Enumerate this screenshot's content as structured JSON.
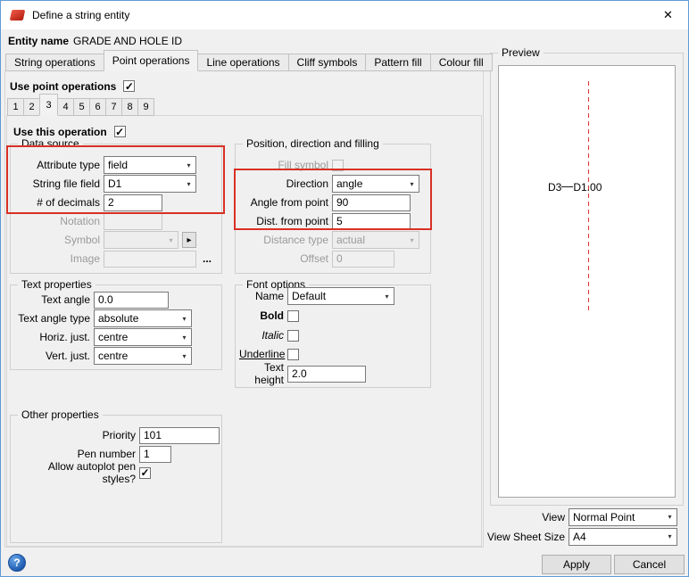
{
  "window": {
    "title": "Define a string entity"
  },
  "icons": {
    "close": "✕",
    "chevron_down": "▾",
    "check": "✓",
    "help": "?",
    "picker": "▸",
    "browse": "..."
  },
  "colors": {
    "annotation": "#d93025",
    "preview_line": "#e03232"
  },
  "entity": {
    "label": "Entity name",
    "value": "GRADE AND HOLE ID"
  },
  "tabs": {
    "items": [
      "String operations",
      "Point operations",
      "Line operations",
      "Cliff symbols",
      "Pattern fill",
      "Colour fill"
    ],
    "active": "Point operations"
  },
  "point_ops": {
    "use_label": "Use point operations"
  },
  "op_tabs": {
    "items": [
      "1",
      "2",
      "3",
      "4",
      "5",
      "6",
      "7",
      "8",
      "9"
    ],
    "active": "3"
  },
  "operation": {
    "use_label": "Use this operation"
  },
  "checks": {
    "use_point_operations": true,
    "use_this_operation": true,
    "fill_symbol": false,
    "bold": false,
    "italic": false,
    "underline": false,
    "autoplot": true
  },
  "data_source": {
    "title": "Data source",
    "attribute_type_label": "Attribute type",
    "attribute_type_value": "field",
    "string_file_field_label": "String file field",
    "string_file_field_value": "D1",
    "decimals_label": "# of decimals",
    "decimals_value": "2",
    "notation_label": "Notation",
    "notation_value": "",
    "symbol_label": "Symbol",
    "symbol_value": "",
    "image_label": "Image",
    "image_value": ""
  },
  "position": {
    "title": "Position, direction and filling",
    "fill_symbol_label": "Fill symbol",
    "direction_label": "Direction",
    "direction_value": "angle",
    "angle_label": "Angle from point",
    "angle_value": "90",
    "dist_label": "Dist. from point",
    "dist_value": "5",
    "distance_type_label": "Distance type",
    "distance_type_value": "actual",
    "offset_label": "Offset",
    "offset_value": "0"
  },
  "text_properties": {
    "title": "Text properties",
    "text_angle_label": "Text angle",
    "text_angle_value": "0.0",
    "text_angle_type_label": "Text angle type",
    "text_angle_type_value": "absolute",
    "horiz_just_label": "Horiz. just.",
    "horiz_just_value": "centre",
    "vert_just_label": "Vert. just.",
    "vert_just_value": "centre"
  },
  "font_options": {
    "title": "Font options",
    "name_label": "Name",
    "name_value": "Default",
    "bold_label": "Bold",
    "italic_label": "Italic",
    "underline_label": "Underline",
    "text_height_label": "Text height",
    "text_height_value": "2.0"
  },
  "other_properties": {
    "title": "Other properties",
    "priority_label": "Priority",
    "priority_value": "101",
    "pen_label": "Pen number",
    "pen_value": "1",
    "autoplot_label": "Allow autoplot pen styles?"
  },
  "preview": {
    "title": "Preview",
    "marker_left": "D3",
    "marker_right": "D1.00",
    "view_label": "View",
    "view_value": "Normal Point",
    "sheet_label": "View Sheet Size",
    "sheet_value": "A4"
  },
  "footer": {
    "apply": "Apply",
    "cancel": "Cancel"
  }
}
